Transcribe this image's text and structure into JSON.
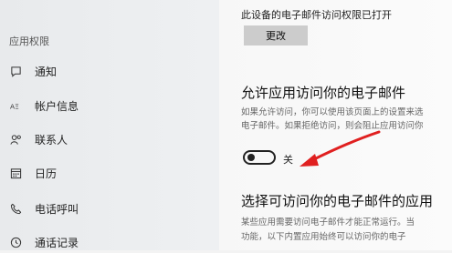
{
  "sidebar": {
    "top_cut_text": "",
    "section_header": "应用权限",
    "partial_item": "",
    "items": [
      {
        "label": "通知",
        "icon": "notification-icon"
      },
      {
        "label": "帐户信息",
        "icon": "account-info-icon"
      },
      {
        "label": "联系人",
        "icon": "contacts-icon"
      },
      {
        "label": "日历",
        "icon": "calendar-icon"
      },
      {
        "label": "电话呼叫",
        "icon": "phone-icon"
      },
      {
        "label": "通话记录",
        "icon": "call-history-icon"
      }
    ]
  },
  "main": {
    "status_text": "此设备的电子邮件访问权限已打开",
    "change_button": "更改",
    "allow_title": "允许应用访问你的电子邮件",
    "allow_desc_line1": "如果允许访问，你可以使用该页面上的设置来选",
    "allow_desc_line2": "电子邮件。如果拒绝访问，则会阻止应用访问你",
    "toggle_state": "关",
    "toggle_on": false,
    "choose_title": "选择可访问你的电子邮件的应用",
    "choose_desc_line1": "某些应用需要访问电子邮件才能正常运行。当",
    "choose_desc_line2": "功能，以下内置应用始终可以访问你的电子"
  },
  "colors": {
    "arrow": "#e02020",
    "button_bg": "#cccccc"
  }
}
